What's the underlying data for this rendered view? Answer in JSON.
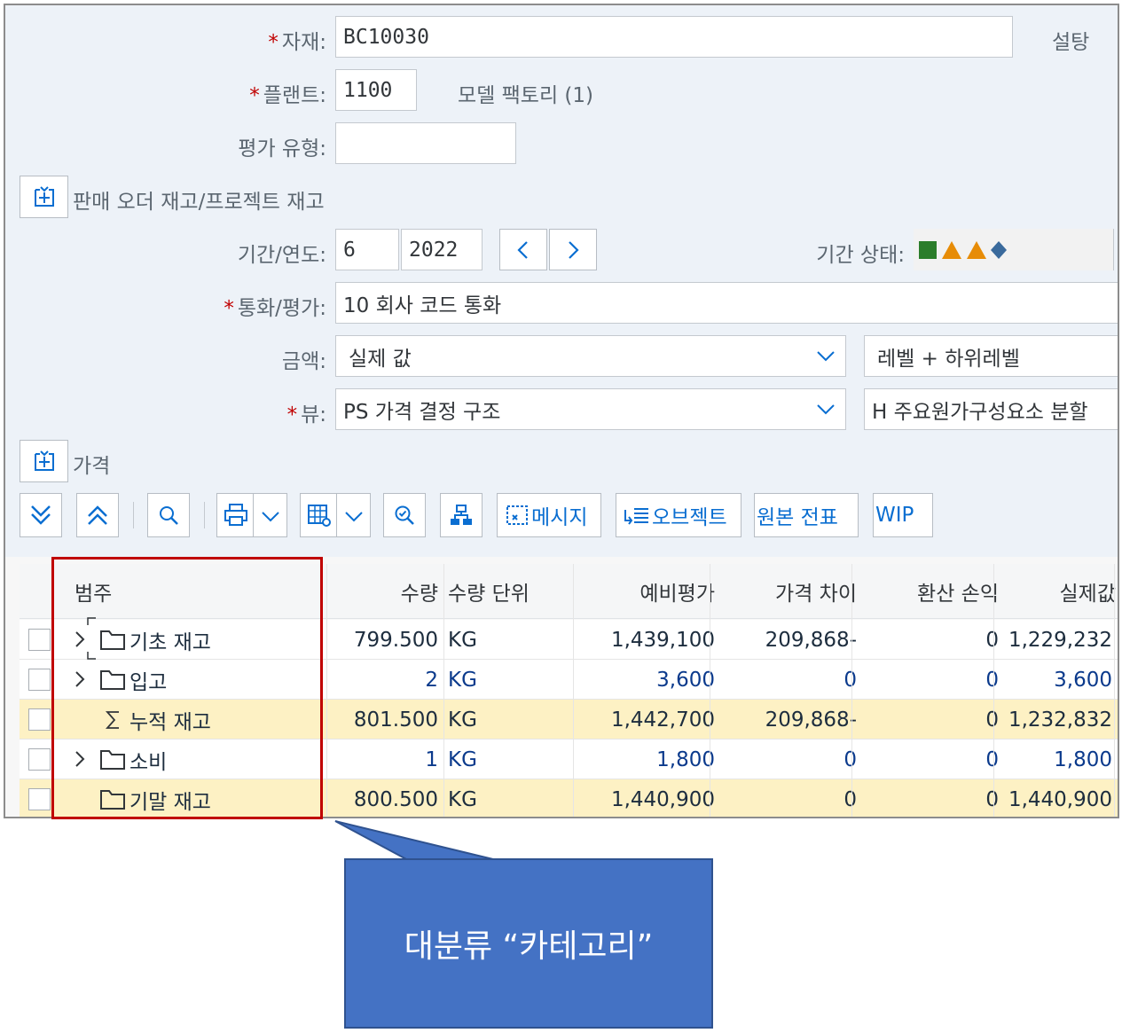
{
  "form": {
    "material": {
      "label": "자재:",
      "value": "BC10030",
      "desc": "설탕"
    },
    "plant": {
      "label": "플랜트:",
      "value": "1100",
      "desc": "모델 팩토리 (1)"
    },
    "valuation_type": {
      "label": "평가 유형:",
      "value": ""
    },
    "sales_order_section": "판매 오더 재고/프로젝트 재고",
    "period": {
      "label": "기간/연도:",
      "period": "6",
      "year": "2022"
    },
    "period_status": {
      "label": "기간 상태:"
    },
    "currency": {
      "label": "통화/평가:",
      "value": "10 회사 코드 통화"
    },
    "amount": {
      "label": "금액:",
      "value": "실제 값",
      "level": "레벨 + 하위레벨"
    },
    "view": {
      "label": "뷰:",
      "value": "PS 가격 결정 구조",
      "breakdown": "H 주요원가구성요소 분할"
    },
    "price_section": "가격",
    "required_mark": "*"
  },
  "toolbar": {
    "messages": "메시지",
    "objects": "오브젝트",
    "original_doc": "원본 전표",
    "wip": "WIP"
  },
  "table": {
    "headers": [
      "범주",
      "수량",
      "수량 단위",
      "예비평가",
      "가격 차이",
      "환산 손익",
      "실제값"
    ],
    "rows": [
      {
        "category": "기초 재고",
        "qty": "799.500",
        "unit": "KG",
        "prelim": "1,439,100",
        "price_diff": "209,868-",
        "exch": "0",
        "actual": "1,229,232"
      },
      {
        "category": "입고",
        "qty": "2",
        "unit": "KG",
        "prelim": "3,600",
        "price_diff": "0",
        "exch": "0",
        "actual": "3,600"
      },
      {
        "category": "누적 재고",
        "qty": "801.500",
        "unit": "KG",
        "prelim": "1,442,700",
        "price_diff": "209,868-",
        "exch": "0",
        "actual": "1,232,832"
      },
      {
        "category": "소비",
        "qty": "1",
        "unit": "KG",
        "prelim": "1,800",
        "price_diff": "0",
        "exch": "0",
        "actual": "1,800"
      },
      {
        "category": "기말 재고",
        "qty": "800.500",
        "unit": "KG",
        "prelim": "1,440,900",
        "price_diff": "0",
        "exch": "0",
        "actual": "1,440,900"
      }
    ]
  },
  "callout": {
    "text": "대분류 “카테고리”"
  },
  "colors": {
    "accent": "#0a6ed1",
    "highlight": "#c00000",
    "callout": "#4472c4",
    "total_row": "#fdf1c4"
  }
}
